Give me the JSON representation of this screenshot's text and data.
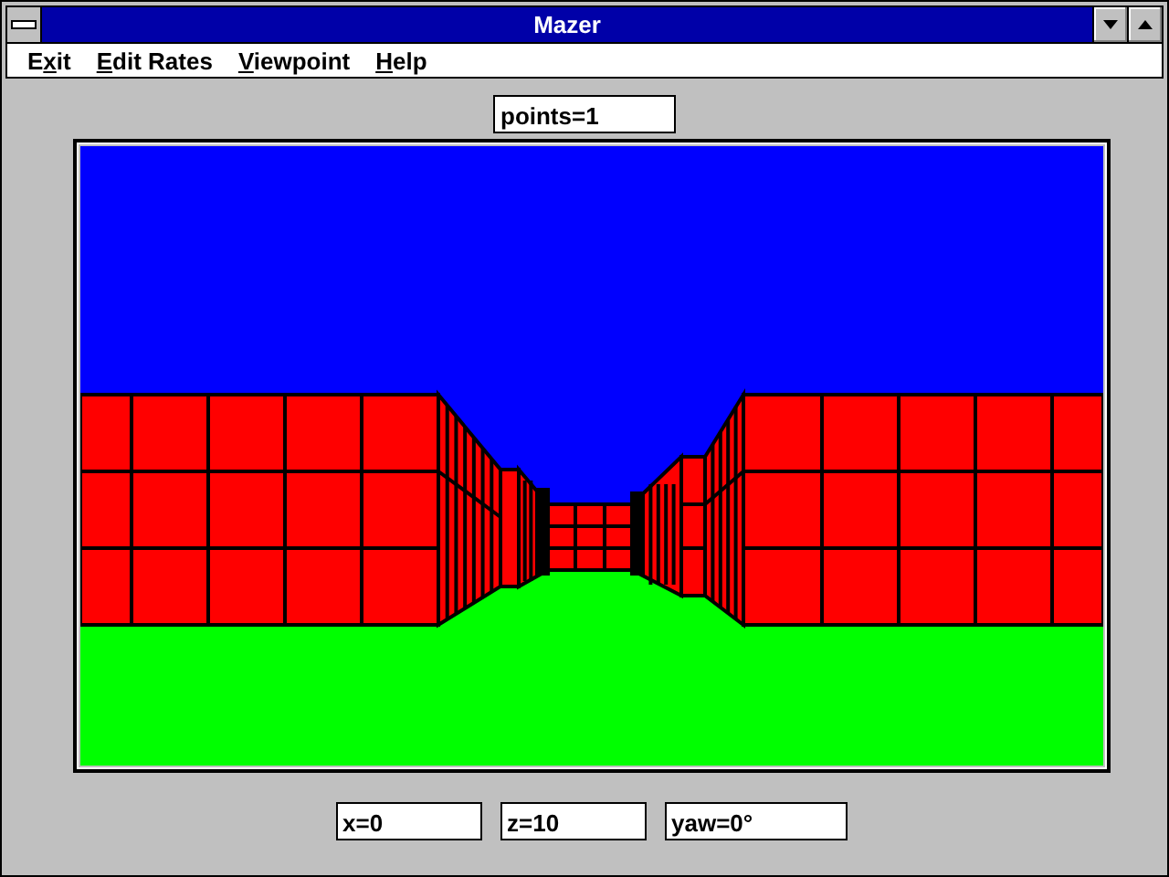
{
  "window": {
    "title": "Mazer"
  },
  "menu": [
    {
      "before_key": "E",
      "underlined_key": "x",
      "after_key": "it"
    },
    {
      "underlined_key": "E",
      "after_key": "dit Rates"
    },
    {
      "underlined_key": "V",
      "after_key": "iewpoint"
    },
    {
      "underlined_key": "H",
      "after_key": "elp"
    }
  ],
  "score": "points=1",
  "readouts": [
    "x=0",
    "z=10",
    "yaw=0°"
  ]
}
